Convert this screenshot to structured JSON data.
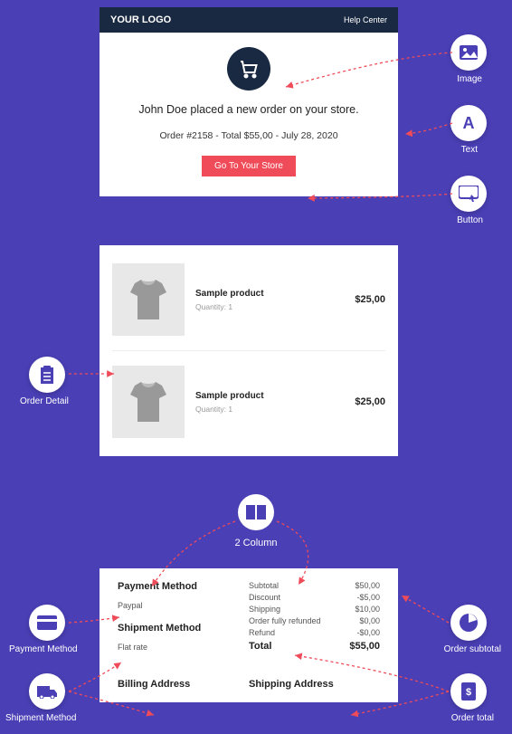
{
  "card1": {
    "logo": "YOUR LOGO",
    "help": "Help Center",
    "message": "John Doe placed a new order on your store.",
    "orderline": "Order #2158 - Total $55,00 - July 28, 2020",
    "button": "Go To Your Store"
  },
  "products": [
    {
      "name": "Sample product",
      "qty": "Quantity: 1",
      "price": "$25,00"
    },
    {
      "name": "Sample product",
      "qty": "Quantity: 1",
      "price": "$25,00"
    }
  ],
  "col2": "2 Column",
  "card3": {
    "payment_method_title": "Payment Method",
    "payment_method_value": "Paypal",
    "shipment_method_title": "Shipment Method",
    "shipment_method_value": "Flat rate",
    "billing_title": "Billing Address",
    "shipping_title": "Shipping Address",
    "totals": [
      {
        "label": "Subtotal",
        "value": "$50,00"
      },
      {
        "label": "Discount",
        "value": "-$5,00"
      },
      {
        "label": "Shipping",
        "value": "$10,00"
      },
      {
        "label": "Order fully refunded",
        "value": "$0,00"
      },
      {
        "label": "Refund",
        "value": "-$0,00"
      }
    ],
    "final_label": "Total",
    "final_value": "$55,00"
  },
  "labels": {
    "image": "Image",
    "text": "Text",
    "button": "Button",
    "order_detail": "Order Detail",
    "payment_method": "Payment Method",
    "shipment_method": "Shipment Method",
    "order_subtotal": "Order subtotal",
    "order_total": "Order total"
  }
}
